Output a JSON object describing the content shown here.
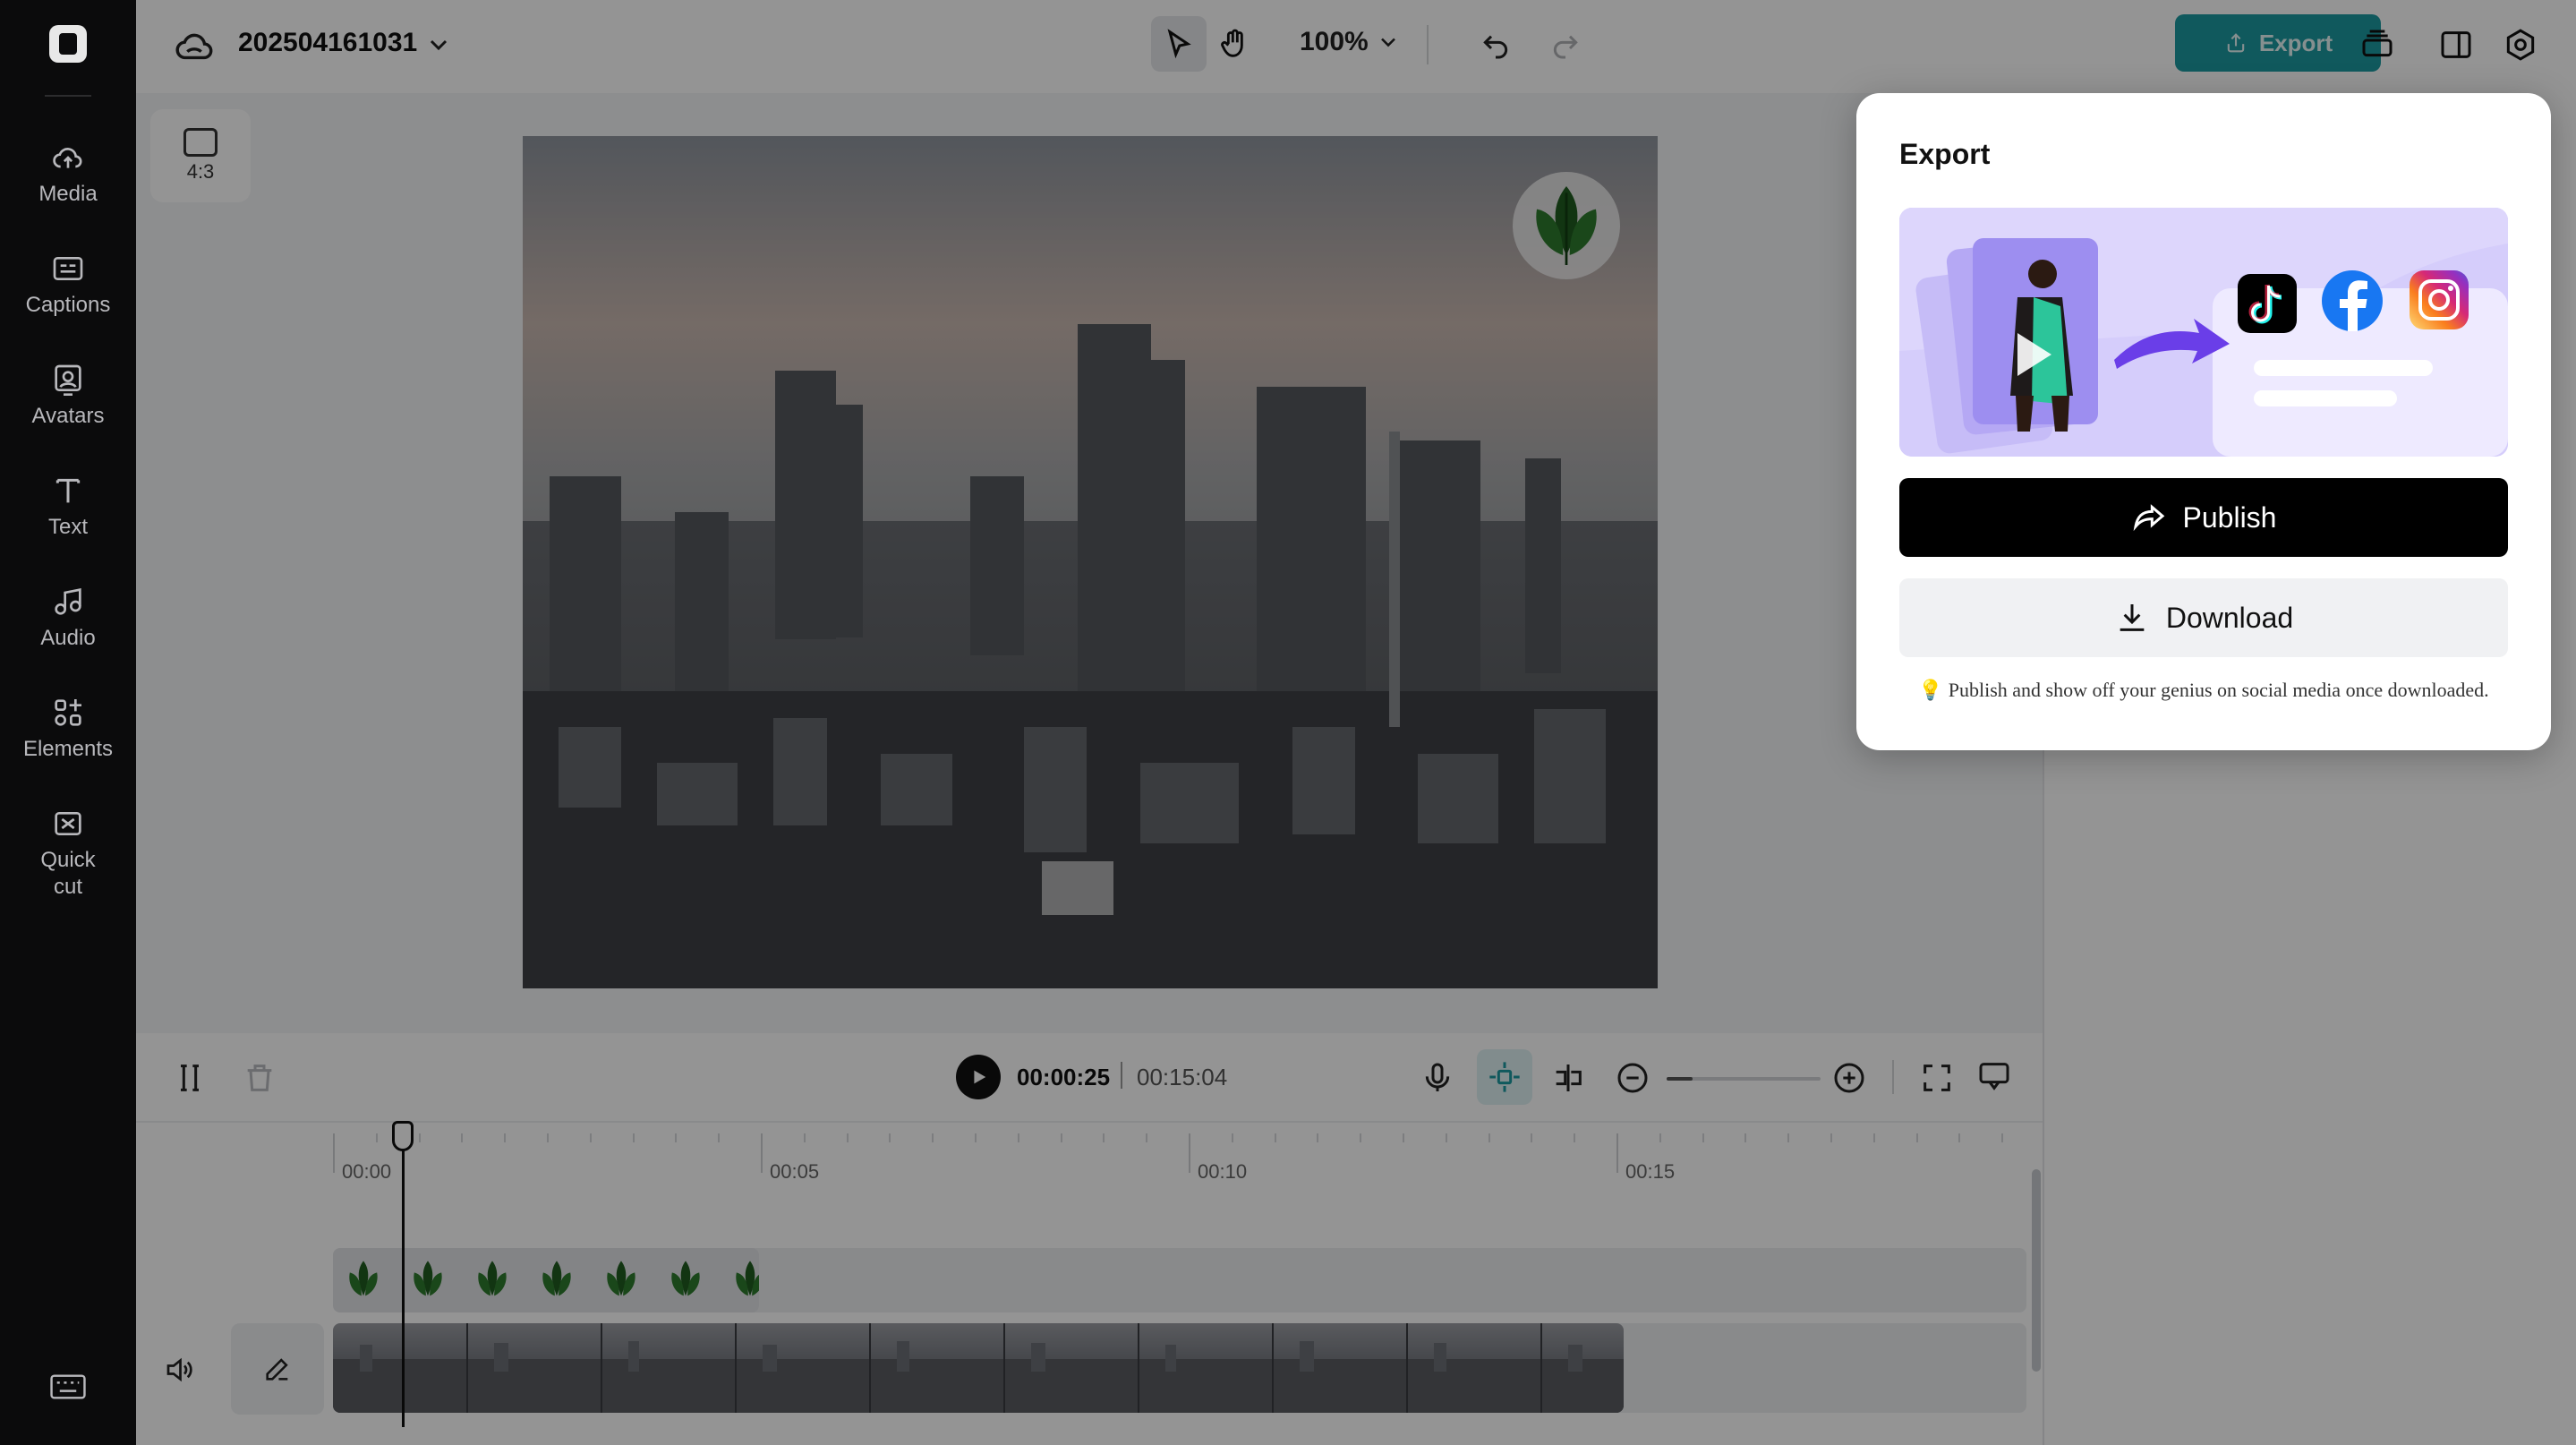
{
  "sidebar": {
    "items": [
      {
        "label": "Media",
        "icon": "cloud-upload-icon"
      },
      {
        "label": "Captions",
        "icon": "captions-icon"
      },
      {
        "label": "Avatars",
        "icon": "avatar-icon"
      },
      {
        "label": "Text",
        "icon": "text-icon"
      },
      {
        "label": "Audio",
        "icon": "music-note-icon"
      },
      {
        "label": "Elements",
        "icon": "elements-icon"
      },
      {
        "label": "Quick cut",
        "icon": "quick-cut-icon"
      }
    ]
  },
  "header": {
    "project_title": "202504161031",
    "zoom": "100%",
    "export_label": "Export"
  },
  "canvas": {
    "aspect_ratio": "4:3"
  },
  "timeline": {
    "current_time": "00:00:25",
    "total_time": "00:15:04",
    "ticks": [
      "00:00",
      "00:05",
      "00:10",
      "00:15"
    ],
    "zoom_level": 0.17
  },
  "export_popup": {
    "title": "Export",
    "publish_label": "Publish",
    "download_label": "Download",
    "hint": "Publish and show off your genius on social media once downloaded.",
    "platforms": [
      "tiktok-icon",
      "facebook-icon",
      "instagram-icon"
    ]
  },
  "colors": {
    "accent": "#1d9aa0",
    "sidebar_bg": "#0b0b0c",
    "banner_bg": "#d5cdfb"
  }
}
